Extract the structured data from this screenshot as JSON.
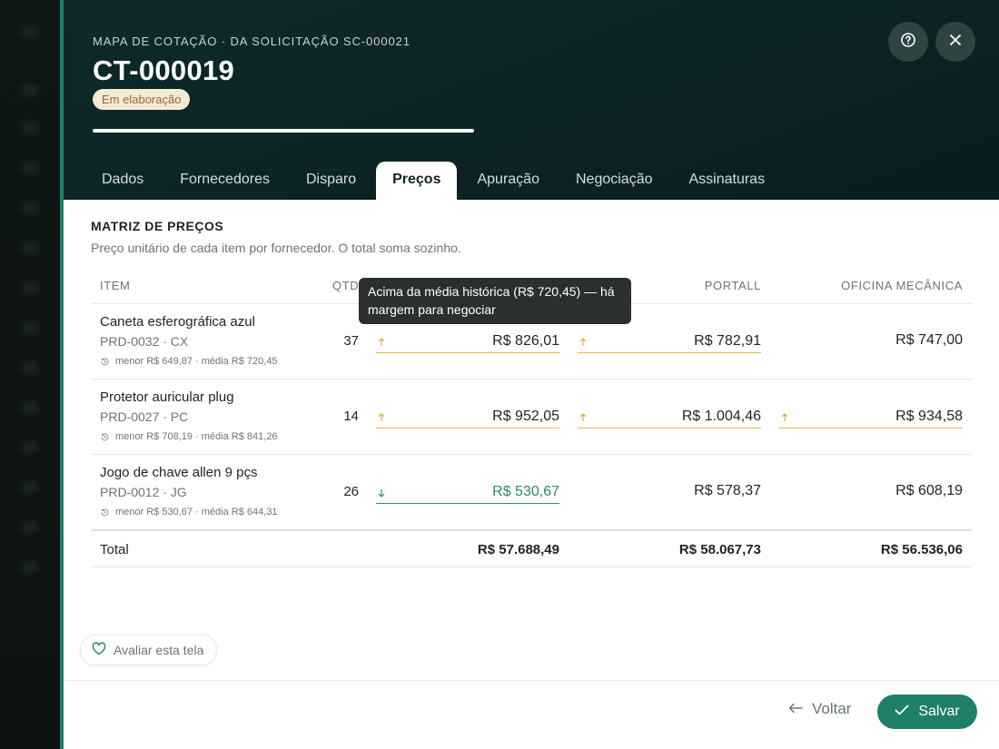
{
  "header": {
    "eyebrow": "MAPA DE COTAÇÃO · DA SOLICITAÇÃO SC-000021",
    "title": "CT-000019",
    "status_badge": "Em elaboração",
    "progress": 1.0
  },
  "header_buttons": {
    "help_icon": "question-circle-icon",
    "close_icon": "close-icon"
  },
  "tabs": [
    "Dados",
    "Fornecedores",
    "Disparo",
    "Preços",
    "Apuração",
    "Negociação",
    "Assinaturas"
  ],
  "active_tab": "Preços",
  "section": {
    "title": "MATRIZ DE PREÇOS",
    "subtitle": "Preço unitário de cada item por fornecedor. O total soma sozinho."
  },
  "table": {
    "columns": {
      "item": "ITEM",
      "qty": "QTD",
      "supplier_2": "PORTALL",
      "supplier_3": "OFICINA MECÂNICA"
    },
    "rows": [
      {
        "name": "Caneta esferográfica azul",
        "code": "PRD-0032 · CX",
        "history": "menor R$ 649,87 · média R$ 720,45",
        "qty": "37",
        "prices": [
          "R$ 826,01",
          "R$ 782,91",
          "R$ 747,00"
        ],
        "trends": [
          "up",
          "up",
          "none"
        ]
      },
      {
        "name": "Protetor auricular plug",
        "code": "PRD-0027 · PC",
        "history": "menor R$ 708,19 · média R$ 841,26",
        "qty": "14",
        "prices": [
          "R$ 952,05",
          "R$ 1.004,46",
          "R$ 934,58"
        ],
        "trends": [
          "up",
          "up",
          "up"
        ]
      },
      {
        "name": "Jogo de chave allen 9 pçs",
        "code": "PRD-0012 · JG",
        "history": "menor R$ 530,67 · média R$ 644,31",
        "qty": "26",
        "prices": [
          "R$ 530,67",
          "R$ 578,37",
          "R$ 608,19"
        ],
        "trends": [
          "down",
          "none",
          "none"
        ]
      }
    ],
    "total_label": "Total",
    "totals": [
      "R$ 57.688,49",
      "R$ 58.067,73",
      "R$ 56.536,06"
    ]
  },
  "tooltip": "Acima da média histórica (R$ 720,45) — há margem para negociar",
  "rate_button": "Avaliar esta tela",
  "footer": {
    "back_label": "Voltar",
    "save_label": "Salvar"
  },
  "colors": {
    "accent": "#1f7f68",
    "warning_underline": "#e8b84a",
    "header_bg": "#0c2325",
    "badge_bg": "#f5ead6"
  }
}
